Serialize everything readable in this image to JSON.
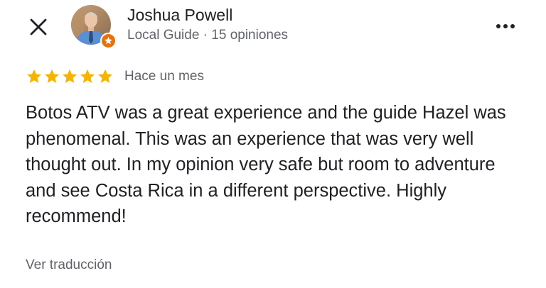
{
  "header": {
    "close_icon": "close-icon",
    "more_icon": "more-horizontal-icon"
  },
  "author": {
    "name": "Joshua Powell",
    "meta": "Local Guide · 15 opiniones",
    "badge_icon": "local-guide-star-icon",
    "badge_color": "#e8710a"
  },
  "review": {
    "rating": 5,
    "rating_max": 5,
    "star_color": "#f6b400",
    "date": "Hace un mes",
    "text": "Botos ATV was a great experience and the guide Hazel was phenomenal. This was an experience that was very well thought out. In my opinion very safe but room to adventure and see Costa Rica in a different perspective. Highly recommend!",
    "translate_label": "Ver traducción"
  }
}
